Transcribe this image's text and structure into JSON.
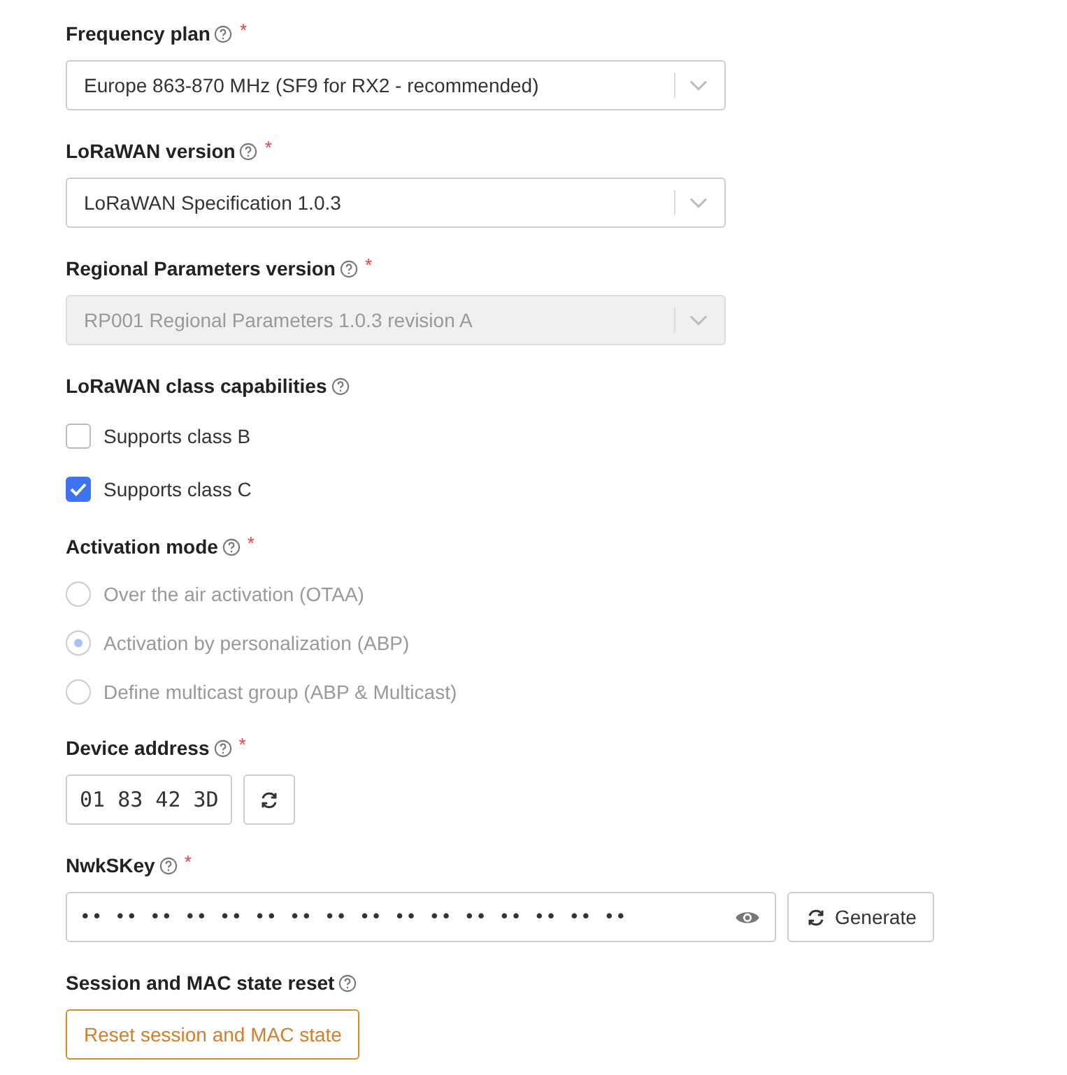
{
  "fields": [
    {
      "kind": "select",
      "label": "Frequency plan",
      "required_mark": "*",
      "value": "Europe 863-870 MHz (SF9 for RX2 - recommended)",
      "disabled": false
    },
    {
      "kind": "select",
      "label": "LoRaWAN version",
      "required_mark": "*",
      "value": "LoRaWAN Specification 1.0.3",
      "disabled": false
    },
    {
      "kind": "select",
      "label": "Regional Parameters version",
      "required_mark": "*",
      "value": "RP001 Regional Parameters 1.0.3 revision A",
      "disabled": true
    },
    {
      "kind": "checkboxes",
      "label": "LoRaWAN class capabilities",
      "options": [
        {
          "label": "Supports class B",
          "checked": false
        },
        {
          "label": "Supports class C",
          "checked": true
        }
      ]
    },
    {
      "kind": "radios",
      "label": "Activation mode",
      "required_mark": "*",
      "disabled": true,
      "options": [
        {
          "label": "Over the air activation (OTAA)",
          "selected": false
        },
        {
          "label": "Activation by personalization (ABP)",
          "selected": true
        },
        {
          "label": "Define multicast group (ABP & Multicast)",
          "selected": false
        }
      ]
    },
    {
      "kind": "address",
      "label": "Device address",
      "required_mark": "*",
      "value": "01 83 42 3D"
    },
    {
      "kind": "key",
      "label": "NwkSKey",
      "required_mark": "*",
      "value": "•• •• •• •• •• •• •• •• •• •• •• •• •• •• •• ••",
      "button": "Generate"
    },
    {
      "kind": "reset",
      "label": "Session and MAC state reset",
      "button": "Reset session and MAC state"
    }
  ]
}
